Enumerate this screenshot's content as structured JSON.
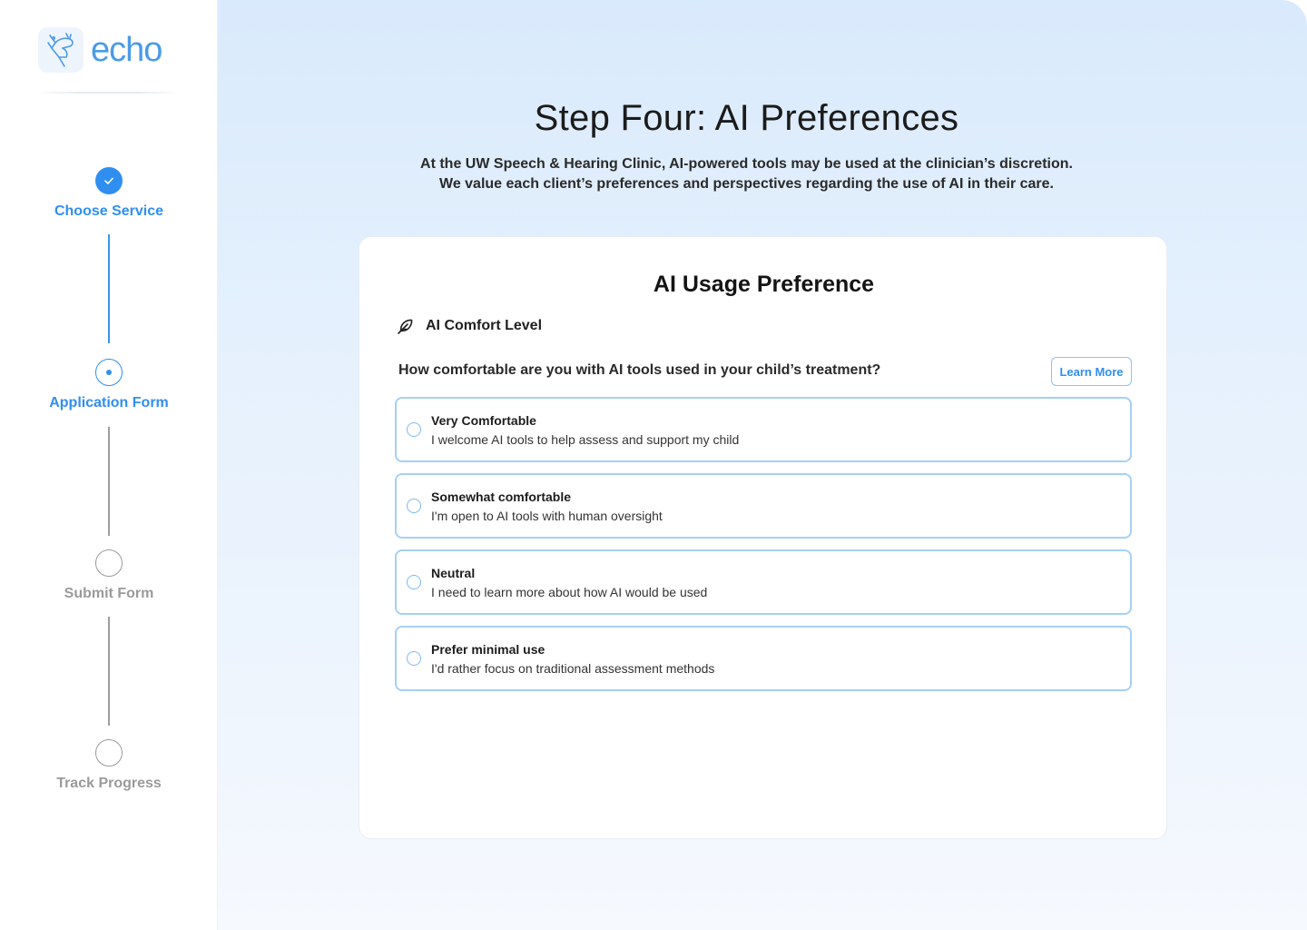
{
  "brand": {
    "name": "echo",
    "color": "#4a9be8"
  },
  "steps": [
    {
      "label": "Choose Service",
      "state": "done"
    },
    {
      "label": "Application Form",
      "state": "current"
    },
    {
      "label": "Submit Form",
      "state": "todo"
    },
    {
      "label": "Track Progress",
      "state": "todo"
    }
  ],
  "page": {
    "title": "Step Four: AI Preferences",
    "subtitle_line1": "At the UW Speech & Hearing Clinic, AI-powered tools may be used at the clinician’s discretion.",
    "subtitle_line2": "We value each client’s preferences and perspectives regarding the use of AI in their care."
  },
  "card": {
    "title": "AI Usage Preference",
    "section_label": "AI Comfort Level",
    "section_icon": "feather-icon",
    "question": "How comfortable are you with AI tools used in your child’s treatment?",
    "learn_more_label": "Learn More",
    "options": [
      {
        "title": "Very Comfortable",
        "desc": "I welcome AI tools to help assess and support my child"
      },
      {
        "title": "Somewhat comfortable",
        "desc": "I'm open to AI tools with human oversight"
      },
      {
        "title": "Neutral",
        "desc": "I need to learn more about how AI would be used"
      },
      {
        "title": "Prefer minimal use",
        "desc": "I'd rather focus on traditional assessment methods"
      }
    ]
  },
  "colors": {
    "accent": "#2f8ff0",
    "inactive": "#9a9a9a",
    "option_border": "#a6d0f6"
  }
}
